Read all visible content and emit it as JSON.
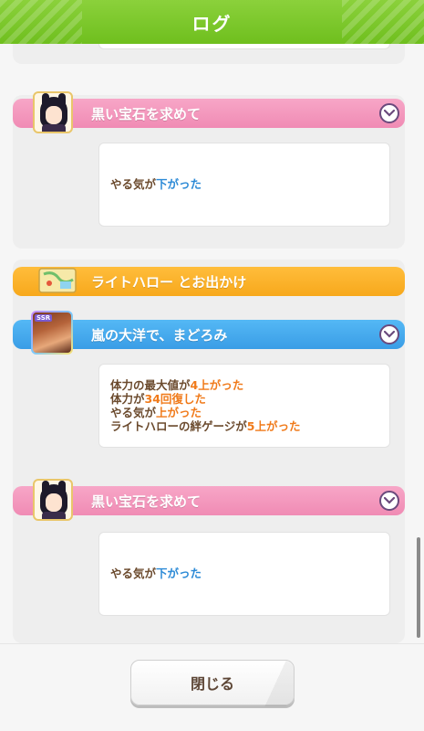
{
  "dialog": {
    "title": "ログ",
    "close_label": "閉じる"
  },
  "entries": [
    {
      "kind": "event",
      "title": "黒い宝石を求めて",
      "header_color": "#f08bb4",
      "lines": [
        [
          {
            "t": "やる気が",
            "c": "normal"
          },
          {
            "t": "下がった",
            "c": "blue"
          }
        ]
      ]
    },
    {
      "kind": "outing",
      "title": "ライトハロー とお出かけ",
      "header_color": "#f7a81c"
    },
    {
      "kind": "event",
      "title": "嵐の大洋で、まどろみ",
      "header_color": "#3a9de6",
      "card_badge": "SSR",
      "lines": [
        [
          {
            "t": "体力の最大値が",
            "c": "normal"
          },
          {
            "t": "4上がった",
            "c": "orange"
          }
        ],
        [
          {
            "t": "体力が",
            "c": "normal"
          },
          {
            "t": "34回復した",
            "c": "orange"
          }
        ],
        [
          {
            "t": "やる気が",
            "c": "normal"
          },
          {
            "t": "上がった",
            "c": "orange"
          }
        ],
        [
          {
            "t": "ライトハローの絆ゲージが",
            "c": "normal"
          },
          {
            "t": "5上がった",
            "c": "orange"
          }
        ]
      ]
    },
    {
      "kind": "event",
      "title": "黒い宝石を求めて",
      "header_color": "#f08bb4",
      "lines": [
        [
          {
            "t": "やる気が",
            "c": "normal"
          },
          {
            "t": "下がった",
            "c": "blue"
          }
        ]
      ]
    }
  ],
  "icons": {
    "expand": "chevron-down-icon",
    "outing": "map-ticket-icon"
  }
}
